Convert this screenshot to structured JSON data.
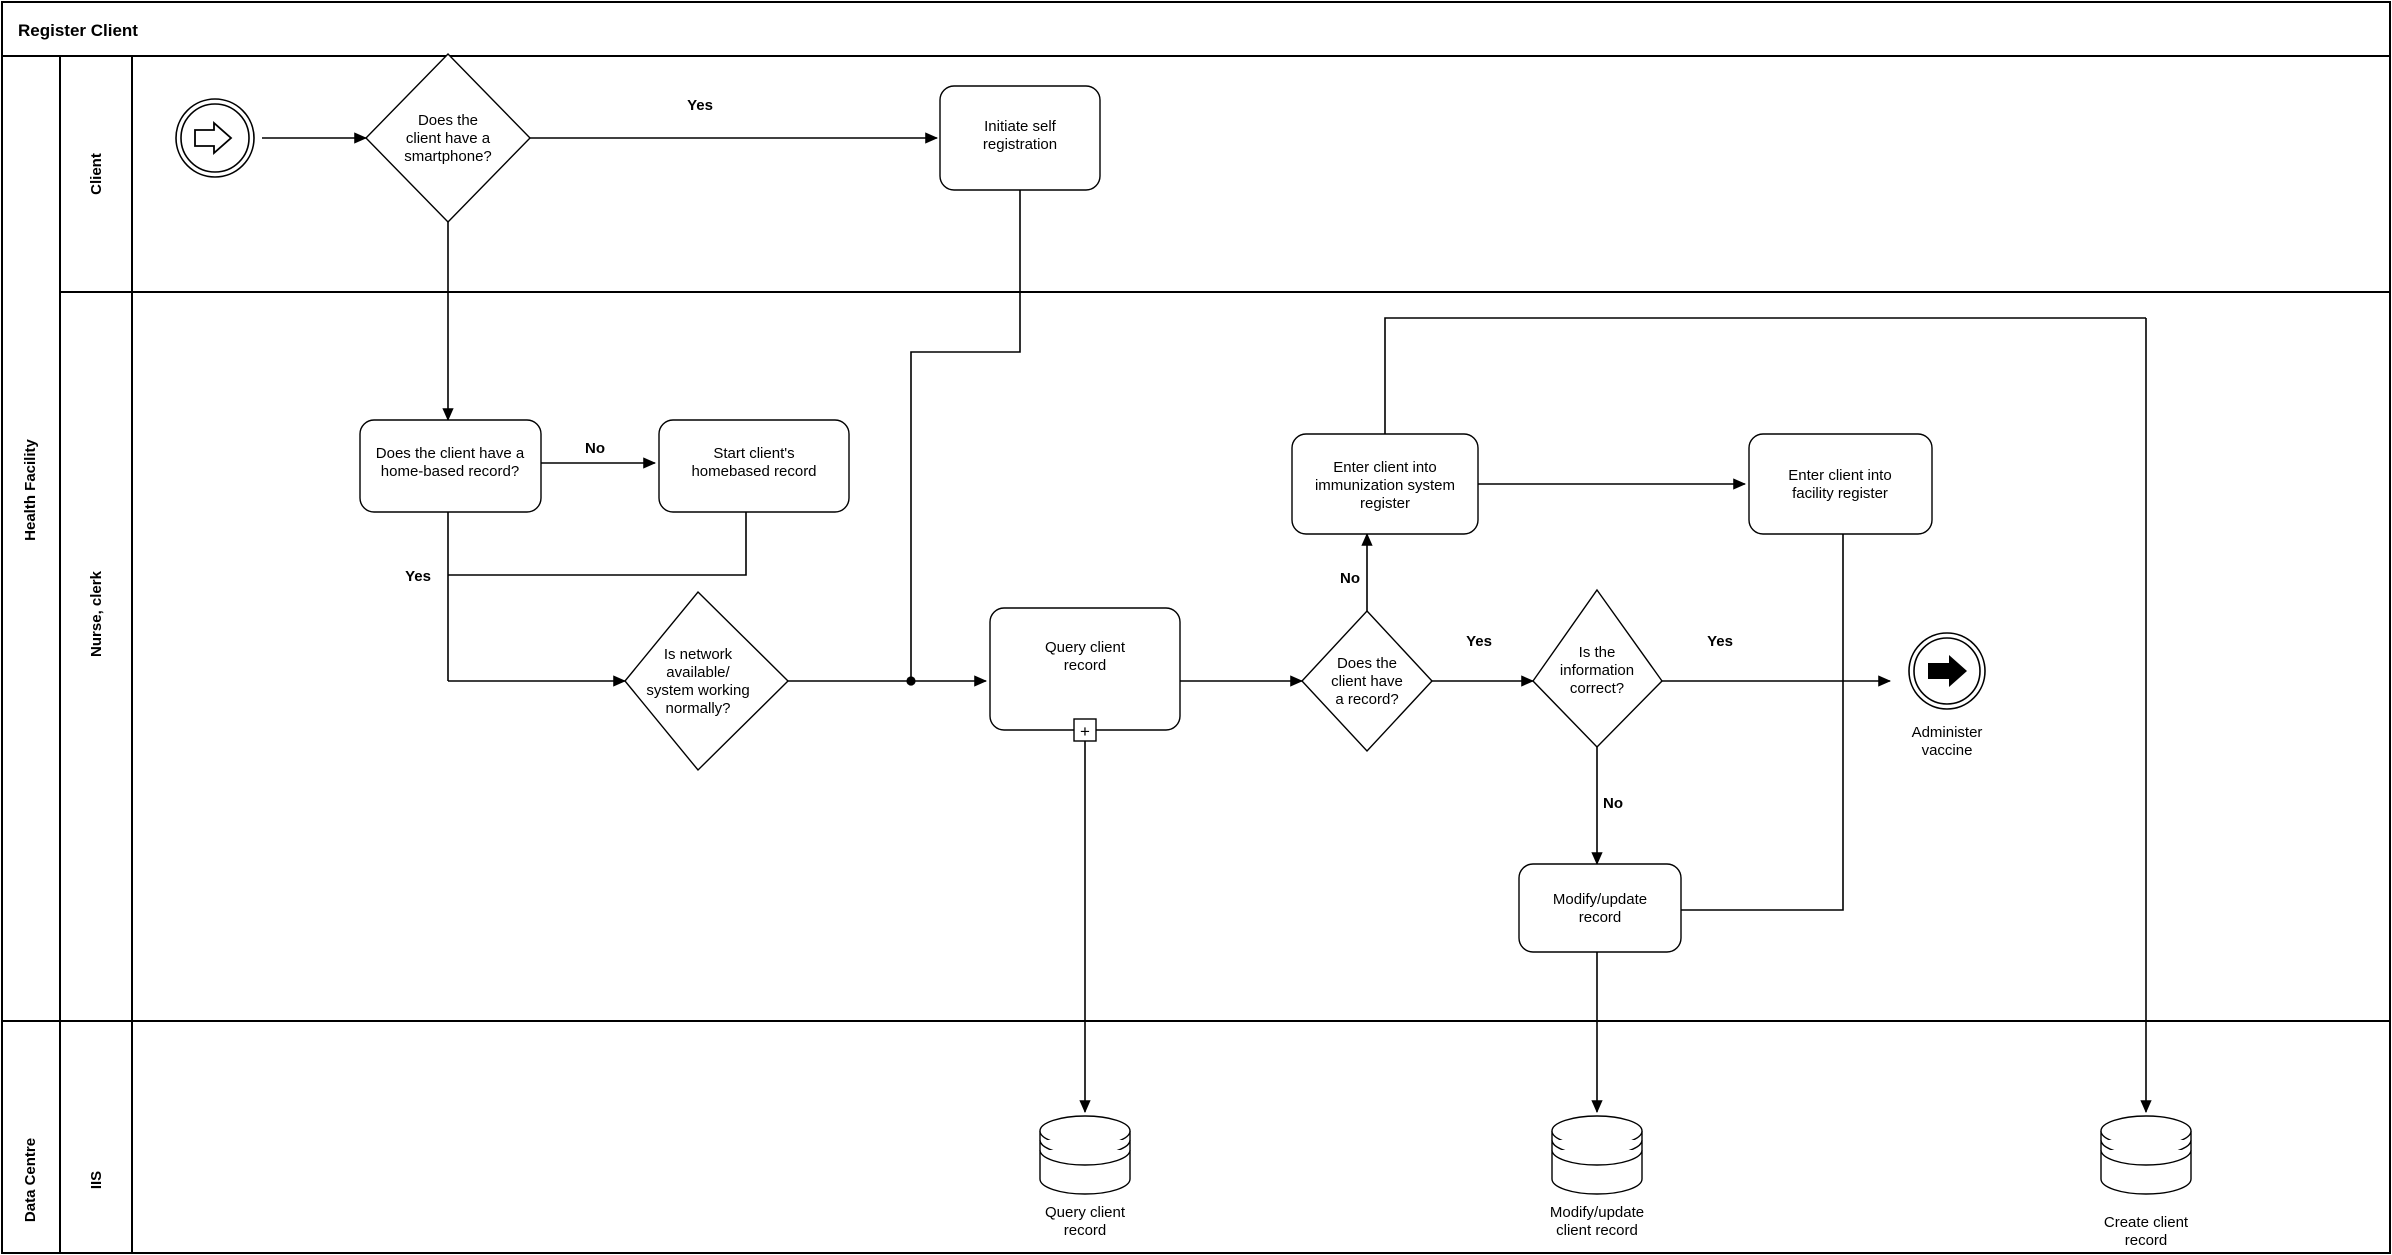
{
  "diagram": {
    "title": "Register Client",
    "type": "bpmn-swimlane-flowchart",
    "accent_color": "#000000",
    "background_color": "#ffffff"
  },
  "pools": [
    {
      "id": "client",
      "label": "Client",
      "lanes": []
    },
    {
      "id": "health_facility",
      "label": "Health Facility",
      "lanes": [
        {
          "id": "nurse_clerk",
          "label": "Nurse, clerk"
        }
      ]
    },
    {
      "id": "data_centre",
      "label": "Data Centre",
      "lanes": [
        {
          "id": "iis",
          "label": "IIS"
        }
      ]
    }
  ],
  "nodes": {
    "start_event": {
      "label": "",
      "shape": "start-event",
      "icon": "arrow-right-outline-icon",
      "pool": "client"
    },
    "gw_smartphone": {
      "label": "Does the\nclient have a\nsmartphone?",
      "shape": "diamond",
      "pool": "client"
    },
    "task_self_reg": {
      "label": "Initiate self\nregistration",
      "shape": "rounded-rect",
      "pool": "client"
    },
    "task_homebased_q": {
      "label": "Does the client have a\nhome-based record?",
      "shape": "rounded-rect",
      "pool": "health_facility"
    },
    "task_start_homebased": {
      "label": "Start client's\nhomebased record",
      "shape": "rounded-rect",
      "pool": "health_facility"
    },
    "gw_network": {
      "label": "Is network\navailable/\nsystem working\nnormally?",
      "shape": "diamond",
      "pool": "health_facility"
    },
    "task_query": {
      "label": "Query client\nrecord",
      "shape": "rounded-rect-subprocess",
      "marker": "plus-icon",
      "pool": "health_facility"
    },
    "gw_has_record": {
      "label": "Does the\nclient have\na record?",
      "shape": "diamond",
      "pool": "health_facility"
    },
    "gw_info_correct": {
      "label": "Is the\ninformation\ncorrect?",
      "shape": "diamond",
      "pool": "health_facility"
    },
    "task_enter_imm": {
      "label": "Enter client into\nimmunization system\nregister",
      "shape": "rounded-rect",
      "pool": "health_facility"
    },
    "task_enter_facility": {
      "label": "Enter client into\nfacility register",
      "shape": "rounded-rect",
      "pool": "health_facility"
    },
    "task_modify": {
      "label": "Modify/update\nrecord",
      "shape": "rounded-rect",
      "pool": "health_facility"
    },
    "end_event": {
      "label": "Administer\nvaccine",
      "shape": "end-event",
      "icon": "arrow-right-solid-icon",
      "pool": "health_facility"
    },
    "ds_query": {
      "label": "Query client\nrecord",
      "shape": "datastore-cylinder",
      "pool": "data_centre"
    },
    "ds_modify": {
      "label": "Modify/update\nclient record",
      "shape": "datastore-cylinder",
      "pool": "data_centre"
    },
    "ds_create": {
      "label": "Create client\nrecord",
      "shape": "datastore-cylinder",
      "pool": "data_centre"
    }
  },
  "node_lines": {
    "gw_smartphone": [
      "Does the",
      "client have a",
      "smartphone?"
    ],
    "task_self_reg": [
      "Initiate self",
      "registration"
    ],
    "task_homebased_q": [
      "Does the client have a",
      "home-based record?"
    ],
    "task_start_homebased": [
      "Start client's",
      "homebased record"
    ],
    "gw_network": [
      "Is network",
      "available/",
      "system working",
      "normally?"
    ],
    "task_query": [
      "Query client",
      "record"
    ],
    "gw_has_record": [
      "Does the",
      "client have",
      "a record?"
    ],
    "gw_info_correct": [
      "Is the",
      "information",
      "correct?"
    ],
    "task_enter_imm": [
      "Enter client into",
      "immunization system",
      "register"
    ],
    "task_enter_facility": [
      "Enter client into",
      "facility register"
    ],
    "task_modify": [
      "Modify/update",
      "record"
    ],
    "end_event": [
      "Administer",
      "vaccine"
    ],
    "ds_query": [
      "Query client",
      "record"
    ],
    "ds_modify": [
      "Modify/update",
      "client record"
    ],
    "ds_create": [
      "Create client",
      "record"
    ]
  },
  "flow_labels": {
    "smartphone_yes": "Yes",
    "homebased_no": "No",
    "homebased_yes": "Yes",
    "has_record_no": "No",
    "has_record_yes": "Yes",
    "info_correct_yes": "Yes",
    "info_correct_no": "No"
  },
  "markers": {
    "subprocess_plus": "+"
  }
}
